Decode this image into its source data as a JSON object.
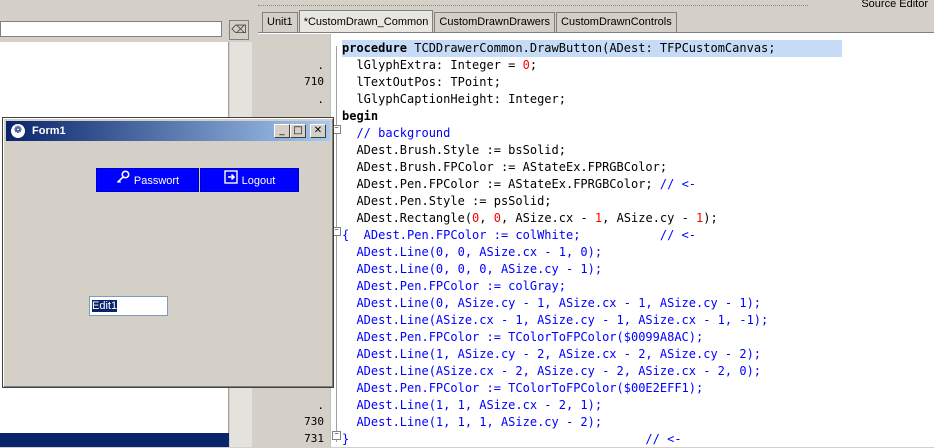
{
  "editor": {
    "title": "Source Editor",
    "tabs": [
      {
        "label": "Unit1",
        "active": false
      },
      {
        "label": "*CustomDrawn_Common",
        "active": true
      },
      {
        "label": "CustomDrawnDrawers",
        "active": false
      },
      {
        "label": "CustomDrawnControls",
        "active": false
      }
    ],
    "line_numbers": {
      "a": ".",
      "b": "710",
      "c": ".",
      "d": ".",
      "e": "730",
      "f": "731"
    },
    "lines": [
      {
        "k": "procedure",
        "rest": " TCDDrawerCommon.DrawButton(ADest: TFPCustomCanvas;"
      },
      {
        "t": "  lGlyphExtra: Integer = ",
        "n": "0",
        "e": ";"
      },
      {
        "t": "  lTextOutPos: TPoint;"
      },
      {
        "t": "  lGlyphCaptionHeight: Integer;"
      },
      {
        "k": "begin"
      },
      {
        "c": "  // background"
      },
      {
        "t": "  ADest.Brush.Style := bsSolid;"
      },
      {
        "t": "  ADest.Brush.FPColor := AStateEx.FPRGBColor;"
      },
      {
        "t": "  ADest.Pen.FPColor := AStateEx.FPRGBColor; ",
        "c": "// <-"
      },
      {
        "t": "  ADest.Pen.Style := psSolid;"
      },
      {
        "t": "  ADest.Rectangle(",
        "n": "0",
        "m": ", ",
        "n2": "0",
        "t2": ", ASize.cx - ",
        "n3": "1",
        "t3": ", ASize.cy - ",
        "n4": "1",
        "e": ");"
      },
      {
        "cb": "{  ADest.Pen.FPColor := colWhite;           // <-"
      },
      {
        "cb": "  ADest.Line(0, 0, ASize.cx - 1, 0);"
      },
      {
        "cb": "  ADest.Line(0, 0, 0, ASize.cy - 1);"
      },
      {
        "cb": "  ADest.Pen.FPColor := colGray;"
      },
      {
        "cb": "  ADest.Line(0, ASize.cy - 1, ASize.cx - 1, ASize.cy - 1);"
      },
      {
        "cb": "  ADest.Line(ASize.cx - 1, ASize.cy - 1, ASize.cx - 1, -1);"
      },
      {
        "cb": "  ADest.Pen.FPColor := TColorToFPColor($0099A8AC);"
      },
      {
        "cb": "  ADest.Line(1, ASize.cy - 2, ASize.cx - 2, ASize.cy - 2);"
      },
      {
        "cb": "  ADest.Line(ASize.cx - 2, ASize.cy - 2, ASize.cx - 2, 0);"
      },
      {
        "cb": "  ADest.Pen.FPColor := TColorToFPColor($00E2EFF1);"
      },
      {
        "cb": "  ADest.Line(1, 1, ASize.cx - 2, 1);"
      },
      {
        "cb": "  ADest.Line(1, 1, 1, ASize.cy - 2);"
      },
      {
        "cb": "}                                         // <-"
      }
    ]
  },
  "form1": {
    "title": "Form1",
    "buttons": {
      "passwort": "Passwort",
      "logout": "Logout"
    },
    "edit_value": "Edit1",
    "caption_min": "_",
    "caption_max": "□",
    "caption_close": "✕"
  },
  "left_panel": {
    "filter_icon": "⌫"
  }
}
